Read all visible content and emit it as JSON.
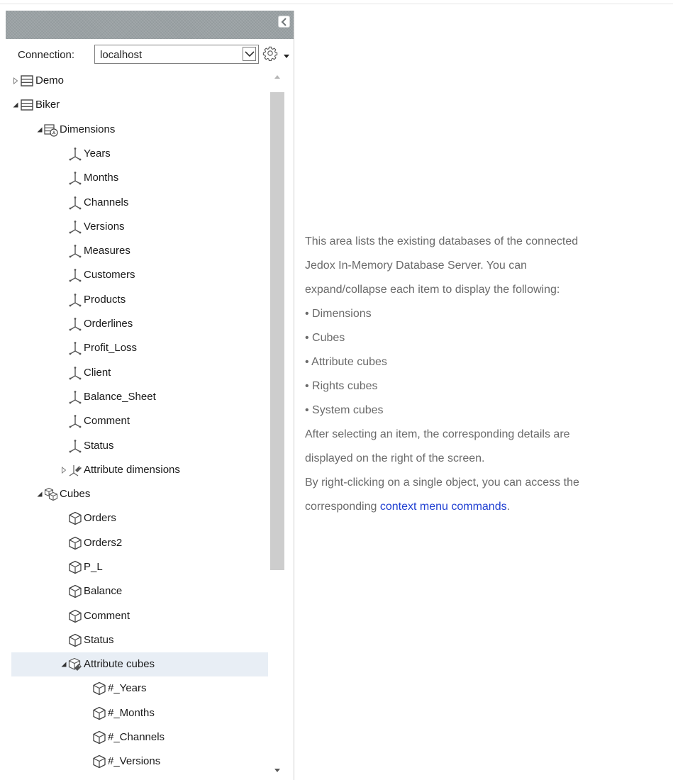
{
  "panel": {
    "connection_label": "Connection:",
    "connection_value": "localhost",
    "collapse_icon": "chevron-left-icon",
    "settings_icon": "gear-icon",
    "menu_icon": "caret-down-icon"
  },
  "tree": {
    "items": [
      {
        "label": "Demo",
        "level": 0,
        "toggle": "collapsed",
        "icon": "database"
      },
      {
        "label": "Biker",
        "level": 0,
        "toggle": "expanded",
        "icon": "database"
      },
      {
        "label": "Dimensions",
        "level": 1,
        "toggle": "expanded",
        "icon": "dimensions-folder"
      },
      {
        "label": "Years",
        "level": 2,
        "toggle": "none",
        "icon": "dimension"
      },
      {
        "label": "Months",
        "level": 2,
        "toggle": "none",
        "icon": "dimension"
      },
      {
        "label": "Channels",
        "level": 2,
        "toggle": "none",
        "icon": "dimension"
      },
      {
        "label": "Versions",
        "level": 2,
        "toggle": "none",
        "icon": "dimension"
      },
      {
        "label": "Measures",
        "level": 2,
        "toggle": "none",
        "icon": "dimension"
      },
      {
        "label": "Customers",
        "level": 2,
        "toggle": "none",
        "icon": "dimension"
      },
      {
        "label": "Products",
        "level": 2,
        "toggle": "none",
        "icon": "dimension"
      },
      {
        "label": "Orderlines",
        "level": 2,
        "toggle": "none",
        "icon": "dimension"
      },
      {
        "label": "Profit_Loss",
        "level": 2,
        "toggle": "none",
        "icon": "dimension"
      },
      {
        "label": "Client",
        "level": 2,
        "toggle": "none",
        "icon": "dimension"
      },
      {
        "label": "Balance_Sheet",
        "level": 2,
        "toggle": "none",
        "icon": "dimension"
      },
      {
        "label": "Comment",
        "level": 2,
        "toggle": "none",
        "icon": "dimension"
      },
      {
        "label": "Status",
        "level": 2,
        "toggle": "none",
        "icon": "dimension"
      },
      {
        "label": "Attribute dimensions",
        "level": 2,
        "toggle": "collapsed",
        "icon": "attribute-dimension"
      },
      {
        "label": "Cubes",
        "level": 1,
        "toggle": "expanded",
        "icon": "cubes-folder"
      },
      {
        "label": "Orders",
        "level": 2,
        "toggle": "none",
        "icon": "cube"
      },
      {
        "label": "Orders2",
        "level": 2,
        "toggle": "none",
        "icon": "cube"
      },
      {
        "label": "P_L",
        "level": 2,
        "toggle": "none",
        "icon": "cube"
      },
      {
        "label": "Balance",
        "level": 2,
        "toggle": "none",
        "icon": "cube"
      },
      {
        "label": "Comment",
        "level": 2,
        "toggle": "none",
        "icon": "cube"
      },
      {
        "label": "Status",
        "level": 2,
        "toggle": "none",
        "icon": "cube"
      },
      {
        "label": "Attribute cubes",
        "level": 2,
        "toggle": "expanded",
        "icon": "attribute-cube",
        "selected": true
      },
      {
        "label": "#_Years",
        "level": 3,
        "toggle": "none",
        "icon": "cube"
      },
      {
        "label": "#_Months",
        "level": 3,
        "toggle": "none",
        "icon": "cube"
      },
      {
        "label": "#_Channels",
        "level": 3,
        "toggle": "none",
        "icon": "cube"
      },
      {
        "label": "#_Versions",
        "level": 3,
        "toggle": "none",
        "icon": "cube"
      }
    ]
  },
  "description": {
    "line1": "This area lists the existing databases of the connected",
    "line2": "Jedox In-Memory Database Server. You can",
    "line3": "expand/collapse each item to display the following:",
    "bullet1": "• Dimensions",
    "bullet2": "• Cubes",
    "bullet3": "• Attribute cubes",
    "bullet4": "• Rights cubes",
    "bullet5": "• System cubes",
    "line4": "After selecting an item, the corresponding details are",
    "line5": "displayed on the right of the screen.",
    "line6": "By right-clicking on a single object, you can access the",
    "line7_prefix": "corresponding ",
    "link": "context menu commands",
    "line7_suffix": "."
  },
  "colors": {
    "header_bg": "#9aa1a4",
    "selected_row_bg": "#e8eef5",
    "link": "#1f3fd2",
    "desc_text": "#6a6a6a"
  }
}
